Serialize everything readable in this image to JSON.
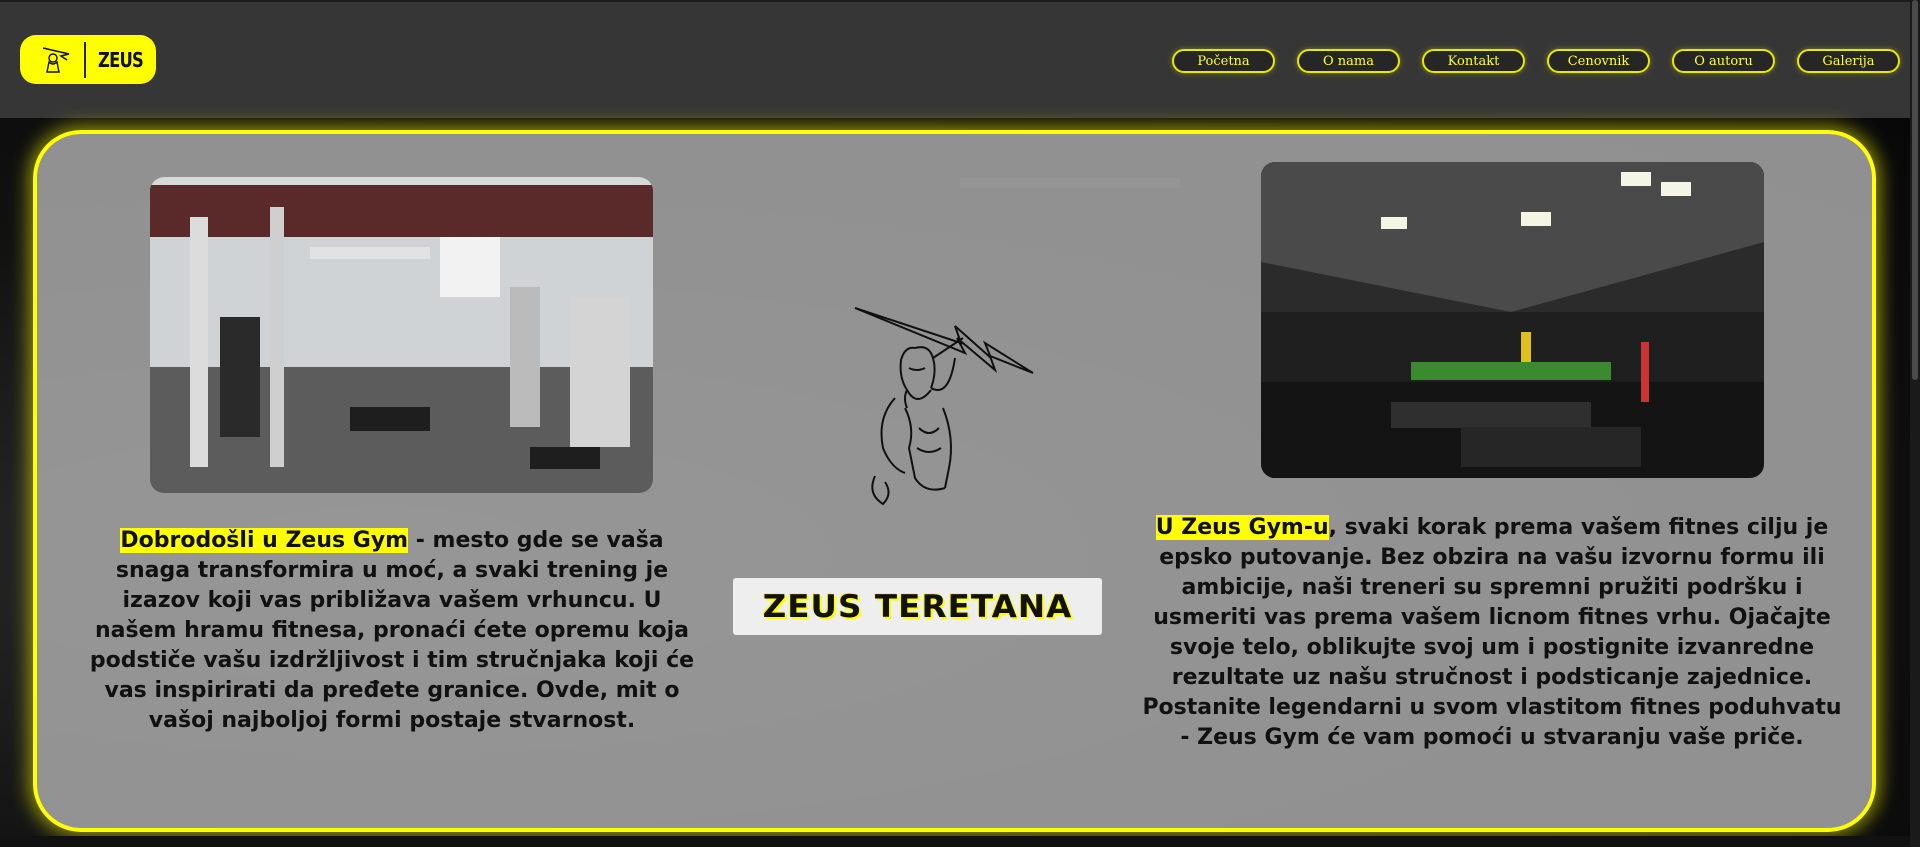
{
  "logo": {
    "text": "ZEUS"
  },
  "nav": {
    "items": [
      {
        "label": "Početna"
      },
      {
        "label": "O nama"
      },
      {
        "label": "Kontakt"
      },
      {
        "label": "Cenovnik"
      },
      {
        "label": "O autoru"
      },
      {
        "label": "Galerija"
      }
    ]
  },
  "left": {
    "highlight": "Dobrodošli u Zeus Gym",
    "body": " - mesto gde se vaša snaga transformira u moć, a svaki trening je izazov koji vas približava vašem vrhuncu. U našem hramu fitnesa, pronaći ćete opremu koja podstiče vašu izdržljivost i tim stručnjaka koji će vas inspirirati da pređete granice. Ovde, mit o vašoj najboljoj formi postaje stvarnost."
  },
  "center": {
    "brand": "ZEUS TERETANA"
  },
  "right": {
    "highlight": "U Zeus Gym-u",
    "body": ", svaki korak prema vašem fitnes cilju je epsko putovanje. Bez obzira na vašu izvornu formu ili ambicije, naši treneri su spremni pružiti podršku i usmeriti vas prema vašem licnom fitnes vrhu. Ojačajte svoje telo, oblikujte svoj um i postignite izvanredne rezultate uz našu stručnost i podsticanje zajednice. Postanite legendarni u svom vlastitom fitnes poduhvatu - Zeus Gym će vam pomoći u stvaranju vaše priče."
  },
  "colors": {
    "accent": "#ffff00",
    "header": "#363636",
    "panel": "#afafaf"
  }
}
